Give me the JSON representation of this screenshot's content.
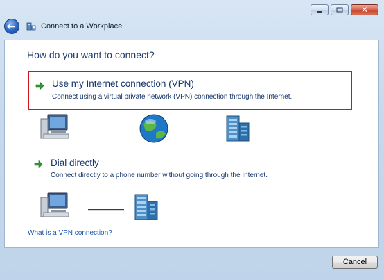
{
  "window": {
    "title": "Connect to a Workplace"
  },
  "main": {
    "heading": "How do you want to connect?",
    "options": [
      {
        "title": "Use my Internet connection (VPN)",
        "description": "Connect using a virtual private network (VPN) connection through the Internet.",
        "icon": "green-arrow-icon",
        "selected": true
      },
      {
        "title": "Dial directly",
        "description": "Connect directly to a phone number without going through the Internet.",
        "icon": "green-arrow-icon",
        "selected": false
      }
    ],
    "help_link": "What is a VPN connection?"
  },
  "footer": {
    "cancel_label": "Cancel"
  },
  "colors": {
    "selection_border": "#d0141c",
    "link": "#1750a8",
    "heading": "#1e3b6d",
    "arrow": "#2e9b2e"
  }
}
